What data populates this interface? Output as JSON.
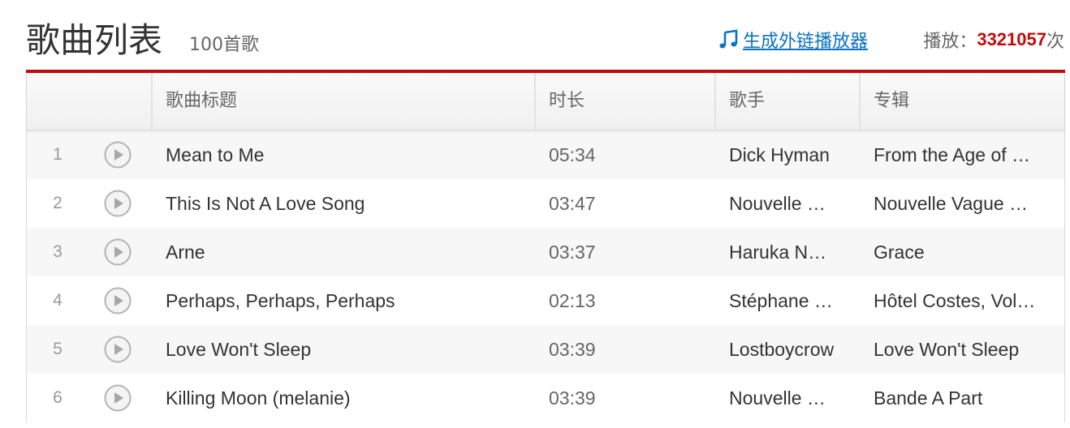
{
  "header": {
    "title": "歌曲列表",
    "song_count": "100首歌",
    "ext_player_link": "生成外链播放器",
    "play_label": "播放：",
    "play_count": "3321057",
    "play_suffix": "次"
  },
  "table": {
    "headers": {
      "title": "歌曲标题",
      "duration": "时长",
      "artist": "歌手",
      "album": "专辑"
    },
    "rows": [
      {
        "index": "1",
        "title": "Mean to Me",
        "duration": "05:34",
        "artist": "Dick Hyman",
        "album": "From the Age of …"
      },
      {
        "index": "2",
        "title": "This Is Not A Love Song",
        "duration": "03:47",
        "artist": "Nouvelle …",
        "album": "Nouvelle Vague …"
      },
      {
        "index": "3",
        "title": "Arne",
        "duration": "03:37",
        "artist": "Haruka N…",
        "album": "Grace"
      },
      {
        "index": "4",
        "title": "Perhaps, Perhaps, Perhaps",
        "duration": "02:13",
        "artist": "Stéphane …",
        "album": "Hôtel Costes, Vol…"
      },
      {
        "index": "5",
        "title": "Love Won't Sleep",
        "duration": "03:39",
        "artist": "Lostboycrow",
        "album": "Love Won't Sleep"
      },
      {
        "index": "6",
        "title": "Killing Moon (melanie)",
        "duration": "03:39",
        "artist": "Nouvelle …",
        "album": "Bande A Part"
      }
    ]
  },
  "colors": {
    "accent_red": "#c20c0c",
    "link_blue": "#0c73c2"
  },
  "icons": {
    "music": "music-note-icon",
    "play": "play-circle-icon"
  }
}
